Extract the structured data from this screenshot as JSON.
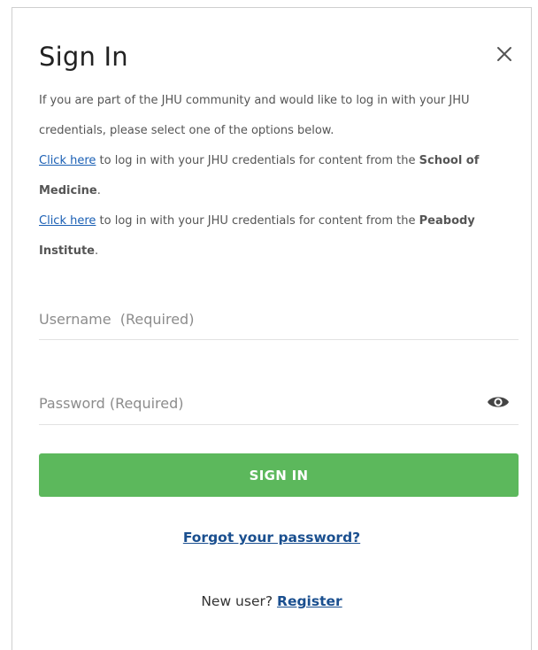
{
  "dialog": {
    "title": "Sign In",
    "intro": {
      "line1": "If you are part of the JHU community and would like to log in with your JHU credentials, please select one of the options below.",
      "som_link": "Click here",
      "som_text": " to log in with your JHU credentials for content from the ",
      "som_name": "School of Medicine",
      "peabody_link": "Click here",
      "peabody_text": " to log in with your JHU credentials for content from the ",
      "peabody_name": "Peabody Institute",
      "period": "."
    },
    "username": {
      "placeholder": "Username  (Required)",
      "value": ""
    },
    "password": {
      "placeholder": "Password (Required)",
      "value": ""
    },
    "signin_label": "SIGN IN",
    "forgot_label": "Forgot your password?",
    "new_user_text": "New user? ",
    "register_label": "Register"
  },
  "icons": {
    "close": "close-icon",
    "password_toggle": "eye-icon"
  },
  "colors": {
    "accent": "#5cb85c",
    "link": "#1a5fb4"
  }
}
